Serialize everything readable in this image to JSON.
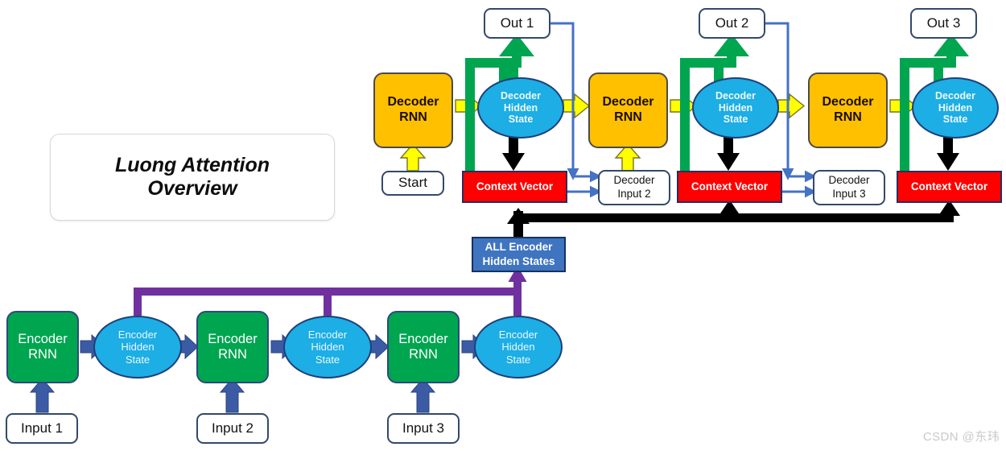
{
  "title": {
    "line1": "Luong Attention",
    "line2": "Overview"
  },
  "colors": {
    "encoder_rnn": "#00A550",
    "decoder_rnn": "#FFC000",
    "hidden_state": "#1CAEE4",
    "context_vector": "#FF0000",
    "all_encoder_hidden_states": "#3F74C0",
    "encoder_arrow": "#3B5BA5",
    "decoder_arrow": "#FFFF00",
    "output_arrow": "#00A550",
    "aggregate_arrow": "#7030A0",
    "attention_bus": "#000000",
    "feedback_arrow": "#4472C4",
    "watermark": "#C9C9C9"
  },
  "encoder": {
    "rnn_label": "Encoder\nRNN",
    "rnn_line1": "Encoder",
    "rnn_line2": "RNN",
    "hidden_line1": "Encoder",
    "hidden_line2": "Hidden",
    "hidden_line3": "State",
    "cells": [
      {
        "rnn": "Encoder RNN",
        "hidden": "Encoder Hidden State",
        "input": "Input 1"
      },
      {
        "rnn": "Encoder RNN",
        "hidden": "Encoder Hidden State",
        "input": "Input 2"
      },
      {
        "rnn": "Encoder RNN",
        "hidden": "Encoder Hidden State",
        "input": "Input 3"
      }
    ],
    "inputs": [
      "Input 1",
      "Input 2",
      "Input 3"
    ]
  },
  "aggregator": {
    "line1": "ALL Encoder",
    "line2": "Hidden States"
  },
  "decoder": {
    "rnn_line1": "Decoder",
    "rnn_line2": "RNN",
    "hidden_line1": "Decoder",
    "hidden_line2": "Hidden",
    "hidden_line3": "State",
    "context_label": "Context Vector",
    "steps": [
      {
        "rnn": "Decoder RNN",
        "hidden": "Decoder Hidden State",
        "context": "Context Vector",
        "output": "Out 1",
        "input_line1": "Start",
        "input_line2": ""
      },
      {
        "rnn": "Decoder RNN",
        "hidden": "Decoder Hidden State",
        "context": "Context Vector",
        "output": "Out 2",
        "input_line1": "Decoder",
        "input_line2": "Input 2"
      },
      {
        "rnn": "Decoder RNN",
        "hidden": "Decoder Hidden State",
        "context": "Context Vector",
        "output": "Out 3",
        "input_line1": "Decoder",
        "input_line2": "Input 3"
      }
    ],
    "outputs": [
      "Out 1",
      "Out 2",
      "Out 3"
    ],
    "start_label": "Start",
    "input2_line1": "Decoder",
    "input2_line2": "Input 2",
    "input3_line1": "Decoder",
    "input3_line2": "Input 3"
  },
  "watermark": "CSDN @东玮"
}
